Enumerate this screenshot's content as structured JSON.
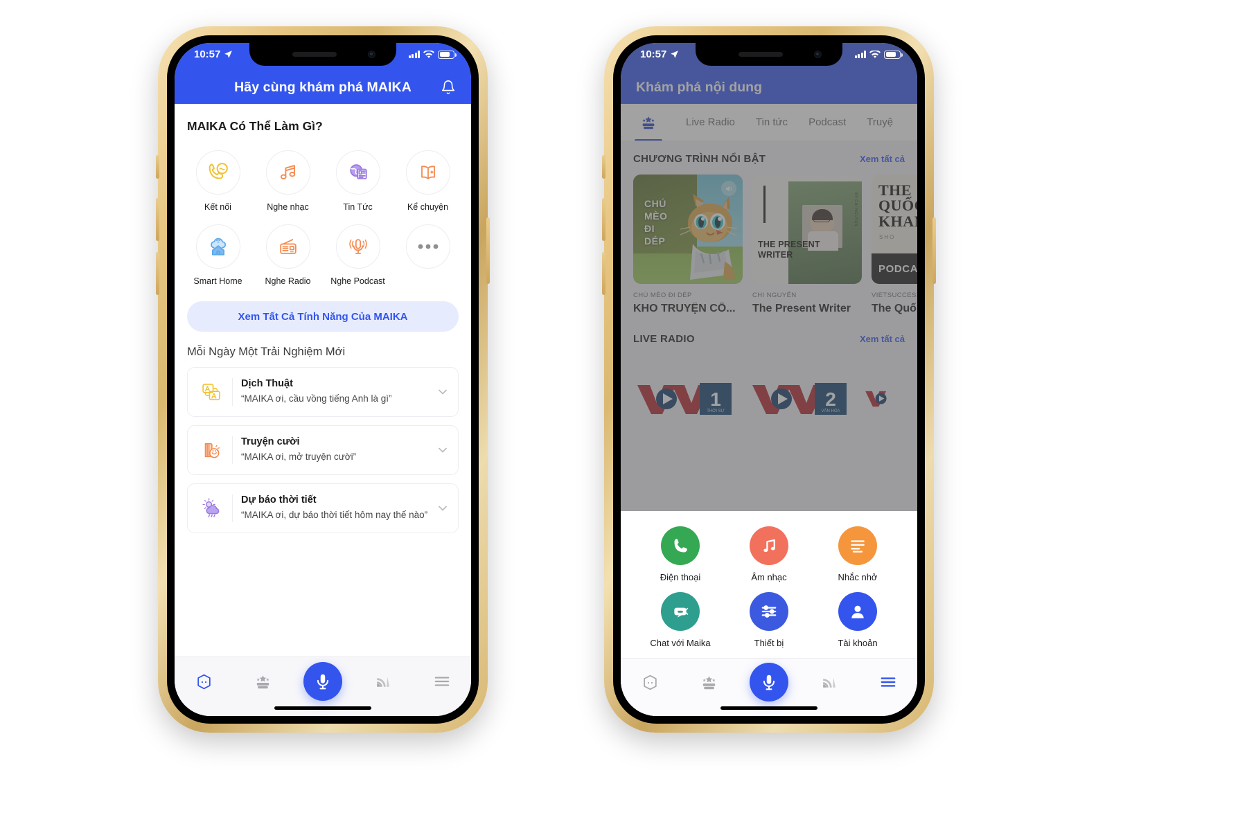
{
  "meta": {
    "accent_blue": "#3355ee",
    "header_blue": "#3355ee",
    "page_bg": "#ffffff"
  },
  "status_bar": {
    "time": "10:57",
    "location_icon": "location-arrow-icon",
    "signal_icon": "cellular-signal-icon",
    "wifi_icon": "wifi-icon",
    "battery_icon": "battery-icon"
  },
  "left_phone": {
    "header": {
      "title": "Hãy cùng khám phá MAIKA",
      "bell_icon": "bell-icon"
    },
    "features_heading": "MAIKA Có Thể Làm Gì?",
    "feature_icons": [
      {
        "label": "Kết nối",
        "icon": "phone-call-icon",
        "color": "#f2c230"
      },
      {
        "label": "Nghe nhạc",
        "icon": "music-note-icon",
        "color": "#f58b52"
      },
      {
        "label": "Tin Tức",
        "icon": "globe-news-icon",
        "color": "#9a7ae0"
      },
      {
        "label": "Kể chuyện",
        "icon": "open-book-icon",
        "color": "#f58b52"
      },
      {
        "label": "Smart Home",
        "icon": "smart-home-icon",
        "color": "#5fa8e8"
      },
      {
        "label": "Nghe Radio",
        "icon": "radio-icon",
        "color": "#f58b52"
      },
      {
        "label": "Nghe Podcast",
        "icon": "microphone-icon",
        "color": "#f58b52"
      },
      {
        "label": "",
        "icon": "more-dots-icon",
        "color": "#8e8e93"
      }
    ],
    "cta_label": "Xem Tất Cả Tính Năng Của MAIKA",
    "experience_heading": "Mỗi Ngày Một Trải Nghiệm Mới",
    "experience_cards": [
      {
        "title": "Dịch Thuật",
        "desc": "“MAIKA ơi, cầu vồng tiếng Anh là gì”",
        "icon": "translate-icon",
        "color": "#f2c230"
      },
      {
        "title": "Truyện cười",
        "desc": "“MAIKA ơi, mở truyện cười”",
        "icon": "joke-book-icon",
        "color": "#f58b52"
      },
      {
        "title": "Dự báo thời tiết",
        "desc": "“MAIKA ơi, dự báo thời tiết hôm nay thế nào”",
        "icon": "weather-icon",
        "color": "#9a7ae0"
      }
    ],
    "tabbar": [
      {
        "name": "home",
        "icon": "home-hexagon-icon",
        "active": true
      },
      {
        "name": "discover",
        "icon": "crown-star-icon",
        "active": false
      },
      {
        "name": "voice",
        "icon": "microphone-fab-icon",
        "active": true
      },
      {
        "name": "cast",
        "icon": "cast-signal-icon",
        "active": false
      },
      {
        "name": "menu",
        "icon": "hamburger-menu-icon",
        "active": false
      }
    ]
  },
  "right_phone": {
    "header": {
      "title": "Khám phá nội dung"
    },
    "tabs": [
      {
        "label": "",
        "icon": "crown-star-icon",
        "active": true
      },
      {
        "label": "Live Radio",
        "active": false
      },
      {
        "label": "Tin tức",
        "active": false
      },
      {
        "label": "Podcast",
        "active": false
      },
      {
        "label": "Truyệ",
        "active": false
      }
    ],
    "featured_section": {
      "title": "CHƯƠNG TRÌNH NỔI BẬT",
      "see_all": "Xem tất cả",
      "cards": [
        {
          "caption": "CHÚ MÈO ĐI DÉP",
          "name": "KHO TRUYỆN CỔ...",
          "thumb_text": "CHÚ MÈO ĐI DÉP",
          "thumb_type": "cat-illustration",
          "badge_icon": "speaker-icon"
        },
        {
          "caption": "CHI NGUYỄN",
          "name": "The Present Writer",
          "thumb_text": "THE PRESENT WRITER",
          "thumb_side_text": "BY CHI NGUYEN",
          "thumb_type": "photo-portrait"
        },
        {
          "caption": "VIETSUCCESS",
          "name": "The Quố",
          "thumb_text": "THE QUOC KHANH SHOW",
          "thumb_sub": "PODCA",
          "thumb_type": "dark-text-poster"
        }
      ]
    },
    "live_radio_section": {
      "title": "LIVE RADIO",
      "see_all": "Xem tất cả",
      "stations": [
        {
          "name": "VOV",
          "channel": "1",
          "sub": "THỜI SỰ"
        },
        {
          "name": "VOV",
          "channel": "2",
          "sub": "VĂN HÓA"
        },
        {
          "name": "VOV",
          "channel": "",
          "sub": ""
        }
      ]
    },
    "quick_sheet": [
      {
        "label": "Điện thoại",
        "icon": "phone-icon",
        "color": "#34a853"
      },
      {
        "label": "Âm nhạc",
        "icon": "music-icon",
        "color": "#f2715c"
      },
      {
        "label": "Nhắc nhở",
        "icon": "reminder-icon",
        "color": "#f5963d"
      },
      {
        "label": "Chat với Maika",
        "icon": "chat-bot-icon",
        "color": "#2e9e8f"
      },
      {
        "label": "Thiết bị",
        "icon": "sliders-icon",
        "color": "#3355ee"
      },
      {
        "label": "Tài khoản",
        "icon": "account-icon",
        "color": "#3355ee"
      }
    ],
    "tabbar": [
      {
        "name": "home",
        "icon": "home-hexagon-icon",
        "active": false
      },
      {
        "name": "discover",
        "icon": "crown-star-icon",
        "active": false
      },
      {
        "name": "voice",
        "icon": "microphone-fab-icon",
        "active": true
      },
      {
        "name": "cast",
        "icon": "cast-signal-icon",
        "active": false
      },
      {
        "name": "menu",
        "icon": "hamburger-menu-icon",
        "active": true
      }
    ]
  }
}
